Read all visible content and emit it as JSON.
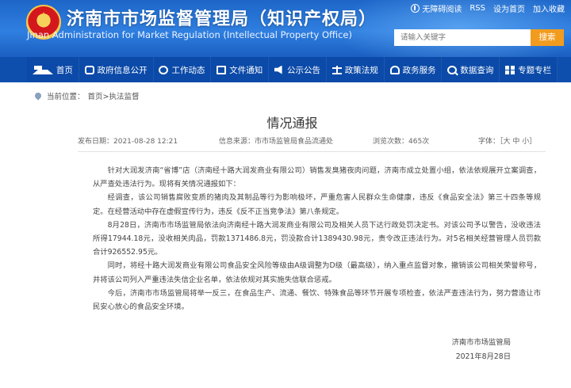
{
  "header": {
    "title_cn": "济南市市场监督管理局（知识产权局）",
    "title_en": "Jinan Administration for Market Regulation (Intellectual Property Office)",
    "links": [
      "无障碍阅读",
      "RSS",
      "设为首页",
      "加入收藏"
    ],
    "search_placeholder": "请输入关键字",
    "search_button": "搜索"
  },
  "nav": {
    "items": [
      {
        "label": "首页",
        "icon": "home-icon"
      },
      {
        "label": "政府信息公开",
        "icon": "layers-icon"
      },
      {
        "label": "工作动态",
        "icon": "chat-icon"
      },
      {
        "label": "文件通知",
        "icon": "document-icon"
      },
      {
        "label": "公示公告",
        "icon": "megaphone-icon"
      },
      {
        "label": "政策法规",
        "icon": "scale-icon"
      },
      {
        "label": "政务服务",
        "icon": "people-icon"
      },
      {
        "label": "数据查询",
        "icon": "search-icon"
      },
      {
        "label": "专题专栏",
        "icon": "grid-icon"
      }
    ]
  },
  "breadcrumb": {
    "prefix": "当前位置：",
    "path": "首页>执法监督"
  },
  "article": {
    "title": "情况通报",
    "meta": {
      "published": "发布日期：2021-08-28 12:21",
      "source": "信息来源：市市场监管局食品流通处",
      "views": "浏览次数：465次",
      "font": "字体：［大 中 小］"
    },
    "paragraphs": [
      "针对大润发济南“省博”店（济南经十路大润发商业有限公司）销售发臭猪夜肉问题，济南市成立处置小组，依法依规展开立案调查，从严查处违法行为。现将有关情况通报如下：",
      "经调查，该公司销售腐败变质的猪肉及其制品等行为影响极坏，严重危害人民群众生命健康，违反《食品安全法》第三十四条等规定。在经营活动中存在虚假宣传行为，违反《反不正当竞争法》第八条规定。",
      "8月28日，济南市市场监管局依法向济南经十路大润发商业有限公司及相关人员下达行政处罚决定书。对该公司予以警告，没收违法所得17944.18元，没收相关肉品，罚款1371486.8元，罚没款合计1389430.98元，责令改正违法行为。对5名相关经营管理人员罚款合计926552.95元。",
      "同时，将经十路大润发商业有限公司食品安全风险等级由A级调整为D级（最高级），纳入重点监督对象，撤销该公司相关荣誉称号，并将该公司列入严重违法失信企业名单，依法依规对其实施失信联合惩戒。",
      "今后，济南市市场监管局将举一反三，在食品生产、流通、餐饮、特殊食品等环节开展专项检查，依法严查违法行为，努力营造让市民安心放心的食品安全环境。"
    ],
    "signature": {
      "org": "济南市市场监管局",
      "date": "2021年8月28日"
    }
  }
}
